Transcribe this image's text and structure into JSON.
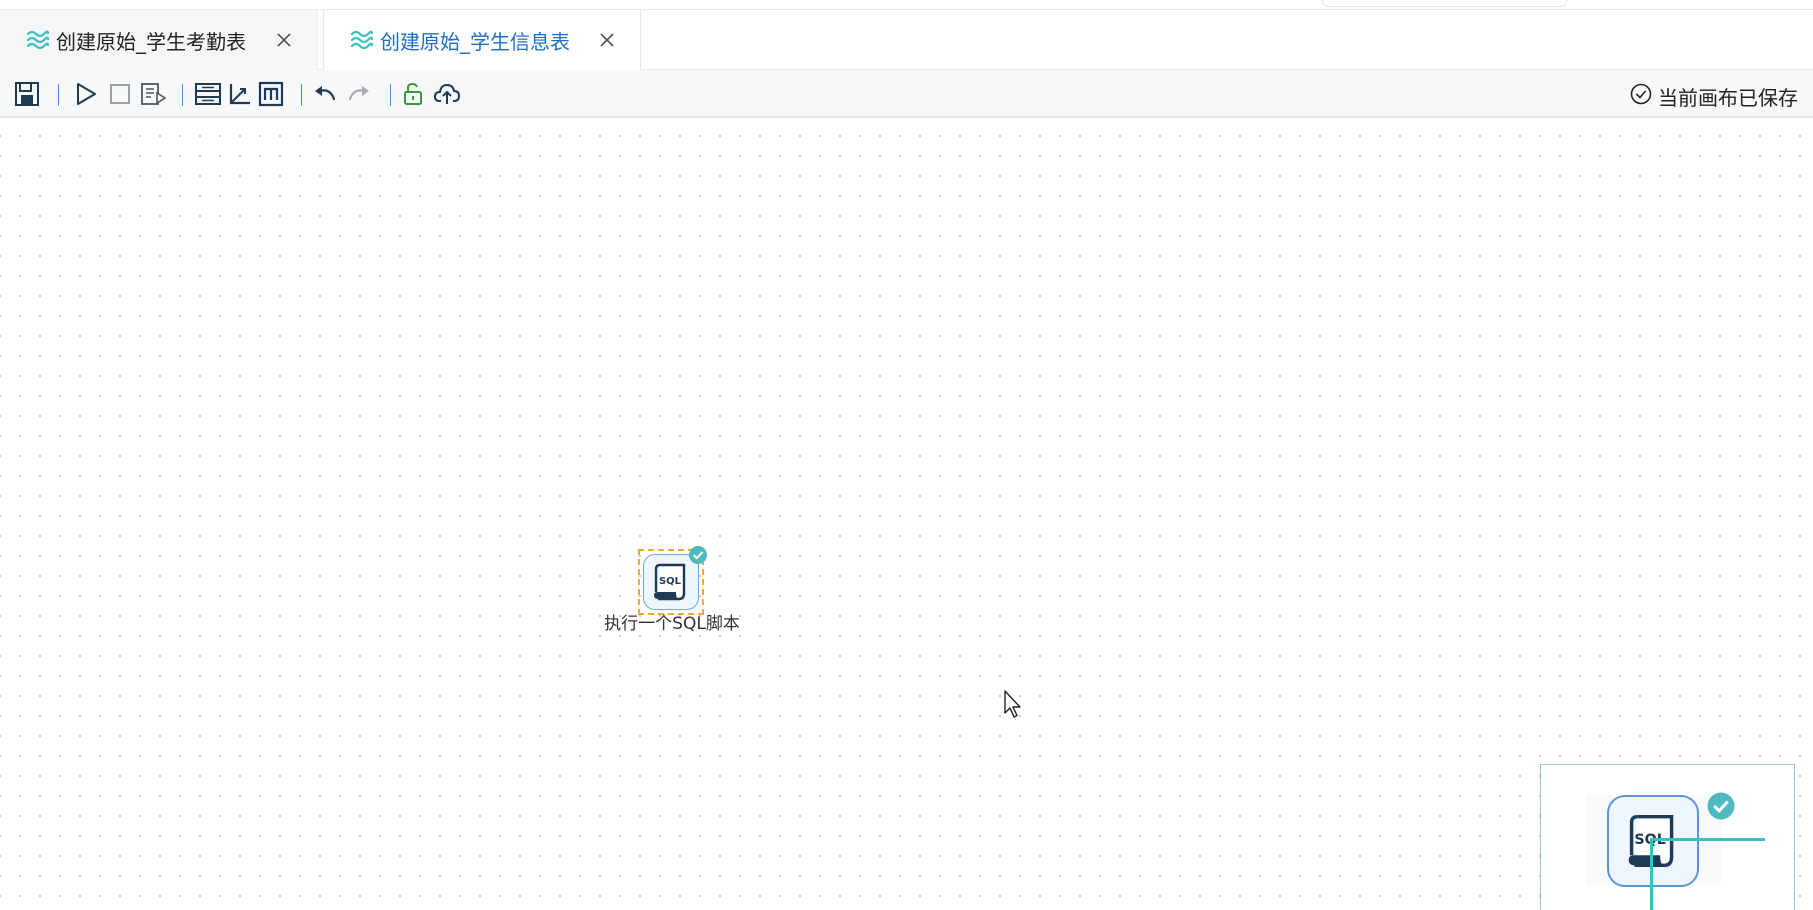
{
  "tabs": [
    {
      "label": "创建原始_学生考勤表",
      "active": false
    },
    {
      "label": "创建原始_学生信息表",
      "active": true
    }
  ],
  "toolbar": {
    "buttons": [
      "save-icon",
      "run-icon",
      "stop-icon",
      "step-run-icon",
      "table-view-icon",
      "axis-icon",
      "m-icon",
      "undo-icon",
      "redo-icon",
      "unlock-icon",
      "cloud-upload-icon"
    ],
    "status_text": "当前画布已保存"
  },
  "canvas": {
    "node": {
      "label": "执行一个SQL脚本",
      "icon_text": "SQL"
    }
  },
  "minimap": {
    "icon_text": "SQL"
  },
  "colors": {
    "accent": "#1e70c4",
    "teal": "#3bbfbf",
    "selection": "#f0a830",
    "dark_icon": "#1f3a56"
  }
}
